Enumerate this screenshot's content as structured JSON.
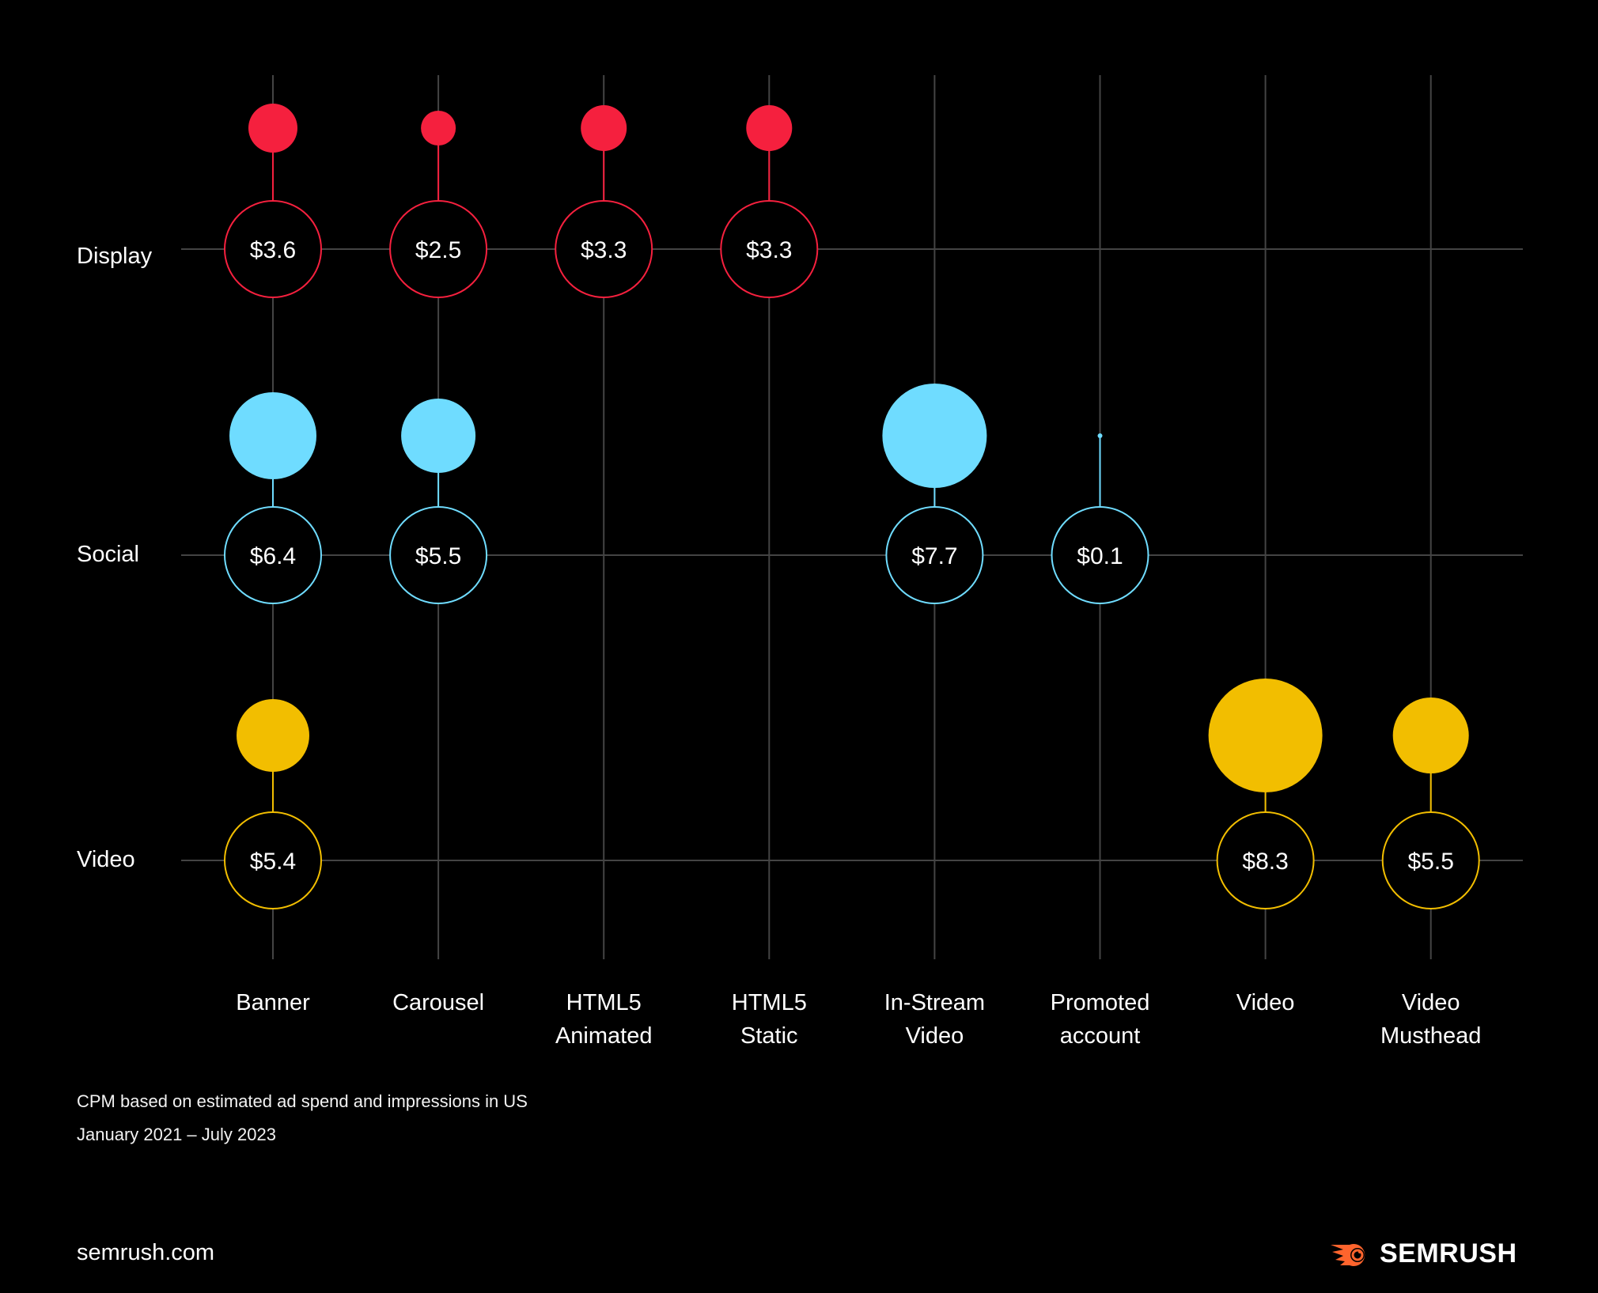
{
  "chart_data": {
    "type": "bubble-matrix",
    "title": "",
    "metric": "CPM (USD)",
    "categories": [
      "Banner",
      "Carousel",
      "HTML5 Animated",
      "HTML5 Static",
      "In-Stream Video",
      "Promoted account",
      "Video",
      "Video Musthead"
    ],
    "category_lines": [
      [
        "Banner"
      ],
      [
        "Carousel"
      ],
      [
        "HTML5",
        "Animated"
      ],
      [
        "HTML5",
        "Static"
      ],
      [
        "In-Stream",
        "Video"
      ],
      [
        "Promoted",
        "account"
      ],
      [
        "Video"
      ],
      [
        "Video",
        "Musthead"
      ]
    ],
    "rows": [
      "Display",
      "Social",
      "Video"
    ],
    "series": [
      {
        "name": "Display",
        "color": "#F5203E",
        "points": [
          {
            "category": "Banner",
            "value": 3.6,
            "label": "$3.6",
            "bubble": 31
          },
          {
            "category": "Carousel",
            "value": 2.5,
            "label": "$2.5",
            "bubble": 22
          },
          {
            "category": "HTML5 Animated",
            "value": 3.3,
            "label": "$3.3",
            "bubble": 29
          },
          {
            "category": "HTML5 Static",
            "value": 3.3,
            "label": "$3.3",
            "bubble": 29
          }
        ]
      },
      {
        "name": "Social",
        "color": "#6FDCFF",
        "points": [
          {
            "category": "Banner",
            "value": 6.4,
            "label": "$6.4",
            "bubble": 55
          },
          {
            "category": "Carousel",
            "value": 5.5,
            "label": "$5.5",
            "bubble": 47
          },
          {
            "category": "In-Stream Video",
            "value": 7.7,
            "label": "$7.7",
            "bubble": 66
          },
          {
            "category": "Promoted account",
            "value": 0.1,
            "label": "$0.1",
            "bubble": 1
          }
        ]
      },
      {
        "name": "Video",
        "color": "#F2BE00",
        "points": [
          {
            "category": "Banner",
            "value": 5.4,
            "label": "$5.4",
            "bubble": 46
          },
          {
            "category": "Video",
            "value": 8.3,
            "label": "$8.3",
            "bubble": 72
          },
          {
            "category": "Video Musthead",
            "value": 5.5,
            "label": "$5.5",
            "bubble": 48
          }
        ]
      }
    ],
    "grid": true
  },
  "notes": {
    "line1": "CPM based on estimated ad spend and impressions in US",
    "line2": "January 2021 – July 2023"
  },
  "footer": {
    "site": "semrush.com",
    "brand": "SEMRUSH",
    "brand_color": "#FF642D"
  }
}
